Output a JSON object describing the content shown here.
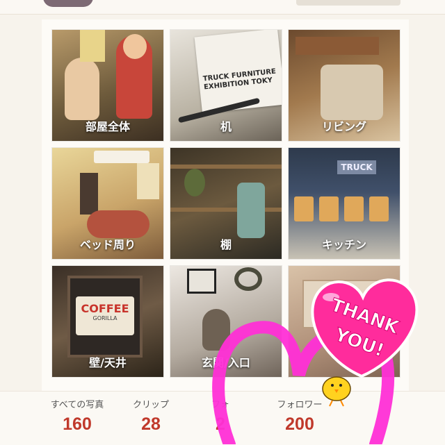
{
  "categories": [
    {
      "label": "部屋全体"
    },
    {
      "label": "机"
    },
    {
      "label": "リビング"
    },
    {
      "label": "ベッド周り"
    },
    {
      "label": "棚"
    },
    {
      "label": "キッチン"
    },
    {
      "label": "壁/天井"
    },
    {
      "label": "玄関/入口"
    },
    {
      "label": ""
    }
  ],
  "photo_text": {
    "exhibition_line1": "TRUCK FURNITURE",
    "exhibition_line2": "EXHIBITION TOKY",
    "kitchen_sign": "TRUCK",
    "coffee_sign": "COFFEE",
    "coffee_sub": "GORILLA"
  },
  "stats": [
    {
      "label": "すべての写真",
      "value": "160"
    },
    {
      "label": "クリップ",
      "value": "28"
    },
    {
      "label": "フォ",
      "value": "2"
    },
    {
      "label": "フォロワー",
      "value": "200"
    }
  ],
  "sticker": {
    "line1": "THANK",
    "line2": "YOU!"
  },
  "colors": {
    "stat_value": "#c0392b",
    "heart_outline": "#ff2fd6",
    "thank_heart": "#ff2c9c",
    "chick": "#ffd21f"
  }
}
